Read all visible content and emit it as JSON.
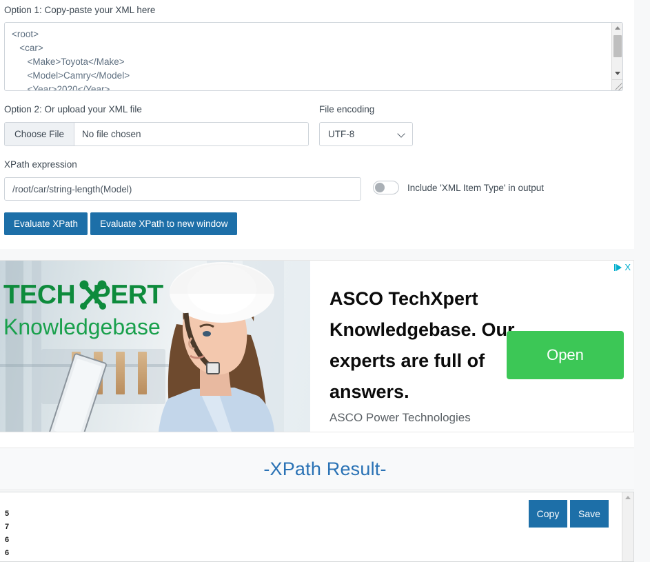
{
  "form": {
    "option1_label": "Option 1: Copy-paste your XML here",
    "xml_content": "<root>\n   <car>\n      <Make>Toyota</Make>\n      <Model>Camry</Model>\n      <Year>2020</Year>",
    "option2_label": "Option 2: Or upload your XML file",
    "choose_file_label": "Choose File",
    "file_name": "No file chosen",
    "encoding_label": "File encoding",
    "encoding_value": "UTF-8",
    "encoding_options": [
      "UTF-8"
    ],
    "xpath_label": "XPath expression",
    "xpath_value": "/root/car/string-length(Model)",
    "xpath_placeholder": "",
    "toggle_label": "Include 'XML Item Type' in output",
    "toggle_state": "off",
    "evaluate_label": "Evaluate XPath",
    "evaluate_new_window_label": "Evaluate XPath to new window"
  },
  "ad": {
    "logo_line1": "TECH PERT",
    "logo_line1_a": "TECH",
    "logo_line1_b": "PERT",
    "logo_line2": "Knowledgebase",
    "headline": "ASCO TechXpert Knowledgebase. Our experts are full of answers.",
    "advertiser": "ASCO Power Technologies",
    "cta_label": "Open",
    "close_label": "X"
  },
  "result": {
    "heading": "-XPath Result-",
    "output": "5\n7\n6\n6",
    "copy_label": "Copy",
    "save_label": "Save"
  },
  "colors": {
    "primary_button": "#1d6fa8",
    "heading": "#2a72b5",
    "ad_cta": "#3cc756",
    "ad_choices": "#00aecd",
    "logo_green": "#0e8b3c"
  }
}
